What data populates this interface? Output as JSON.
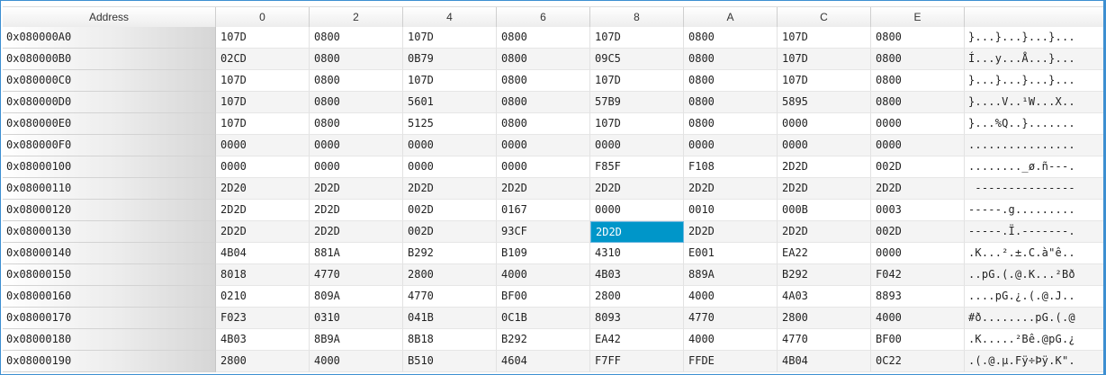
{
  "columns": [
    "Address",
    "0",
    "2",
    "4",
    "6",
    "8",
    "A",
    "C",
    "E",
    ""
  ],
  "selected": {
    "row": 9,
    "col": 4
  },
  "selection_color": "#0096c9",
  "rows": [
    {
      "address": "0x080000A0",
      "words": [
        "107D",
        "0800",
        "107D",
        "0800",
        "107D",
        "0800",
        "107D",
        "0800"
      ],
      "ascii": "}...}...}...}..."
    },
    {
      "address": "0x080000B0",
      "words": [
        "02CD",
        "0800",
        "0B79",
        "0800",
        "09C5",
        "0800",
        "107D",
        "0800"
      ],
      "ascii": "Í...y...Å...}..."
    },
    {
      "address": "0x080000C0",
      "words": [
        "107D",
        "0800",
        "107D",
        "0800",
        "107D",
        "0800",
        "107D",
        "0800"
      ],
      "ascii": "}...}...}...}..."
    },
    {
      "address": "0x080000D0",
      "words": [
        "107D",
        "0800",
        "5601",
        "0800",
        "57B9",
        "0800",
        "5895",
        "0800"
      ],
      "ascii": "}....V..¹W...X.."
    },
    {
      "address": "0x080000E0",
      "words": [
        "107D",
        "0800",
        "5125",
        "0800",
        "107D",
        "0800",
        "0000",
        "0000"
      ],
      "ascii": "}...%Q..}......."
    },
    {
      "address": "0x080000F0",
      "words": [
        "0000",
        "0000",
        "0000",
        "0000",
        "0000",
        "0000",
        "0000",
        "0000"
      ],
      "ascii": "................"
    },
    {
      "address": "0x08000100",
      "words": [
        "0000",
        "0000",
        "0000",
        "0000",
        "F85F",
        "F108",
        "2D2D",
        "002D"
      ],
      "ascii": "........_ø.ñ---."
    },
    {
      "address": "0x08000110",
      "words": [
        "2D20",
        "2D2D",
        "2D2D",
        "2D2D",
        "2D2D",
        "2D2D",
        "2D2D",
        "2D2D"
      ],
      "ascii": " ---------------"
    },
    {
      "address": "0x08000120",
      "words": [
        "2D2D",
        "2D2D",
        "002D",
        "0167",
        "0000",
        "0010",
        "000B",
        "0003"
      ],
      "ascii": "-----.g........."
    },
    {
      "address": "0x08000130",
      "words": [
        "2D2D",
        "2D2D",
        "002D",
        "93CF",
        "2D2D",
        "2D2D",
        "2D2D",
        "002D"
      ],
      "ascii": "-----.Ï.-------."
    },
    {
      "address": "0x08000140",
      "words": [
        "4B04",
        "881A",
        "B292",
        "B109",
        "4310",
        "E001",
        "EA22",
        "0000"
      ],
      "ascii": ".K...².±.C.à\"ê.."
    },
    {
      "address": "0x08000150",
      "words": [
        "8018",
        "4770",
        "2800",
        "4000",
        "4B03",
        "889A",
        "B292",
        "F042"
      ],
      "ascii": "..pG.(.@.K...²Bð"
    },
    {
      "address": "0x08000160",
      "words": [
        "0210",
        "809A",
        "4770",
        "BF00",
        "2800",
        "4000",
        "4A03",
        "8893"
      ],
      "ascii": "....pG.¿.(.@.J.."
    },
    {
      "address": "0x08000170",
      "words": [
        "F023",
        "0310",
        "041B",
        "0C1B",
        "8093",
        "4770",
        "2800",
        "4000"
      ],
      "ascii": "#ð........pG.(.@"
    },
    {
      "address": "0x08000180",
      "words": [
        "4B03",
        "8B9A",
        "8B18",
        "B292",
        "EA42",
        "4000",
        "4770",
        "BF00"
      ],
      "ascii": ".K.....²Bê.@pG.¿"
    },
    {
      "address": "0x08000190",
      "words": [
        "2800",
        "4000",
        "B510",
        "4604",
        "F7FF",
        "FFDE",
        "4B04",
        "0C22"
      ],
      "ascii": ".(.@.µ.Fÿ÷Þÿ.K\"."
    }
  ]
}
